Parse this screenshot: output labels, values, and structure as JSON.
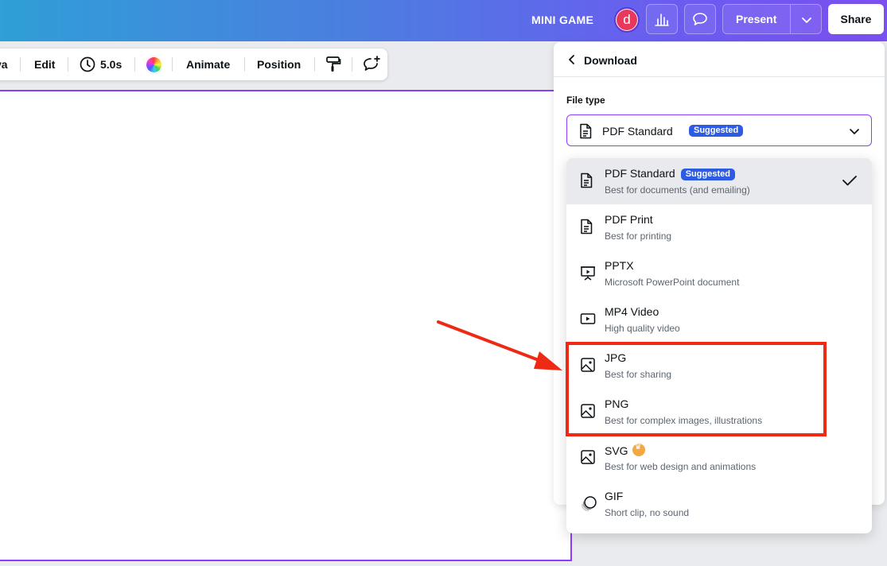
{
  "header": {
    "title": "MINI GAME",
    "avatar_letter": "d",
    "present_label": "Present",
    "share_label": "Share"
  },
  "toolbar": {
    "truncated_label": "va",
    "edit_label": "Edit",
    "duration_label": "5.0s",
    "animate_label": "Animate",
    "position_label": "Position"
  },
  "download_panel": {
    "title": "Download",
    "file_type_label": "File type",
    "selected_value": "PDF Standard",
    "selected_badge": "Suggested",
    "options": [
      {
        "name": "PDF Standard",
        "badge": "Suggested",
        "desc": "Best for documents (and emailing)",
        "icon": "document-icon",
        "selected": true
      },
      {
        "name": "PDF Print",
        "desc": "Best for printing",
        "icon": "document-icon"
      },
      {
        "name": "PPTX",
        "desc": "Microsoft PowerPoint document",
        "icon": "presentation-icon"
      },
      {
        "name": "MP4 Video",
        "desc": "High quality video",
        "icon": "video-icon"
      },
      {
        "name": "JPG",
        "desc": "Best for sharing",
        "icon": "image-icon"
      },
      {
        "name": "PNG",
        "desc": "Best for complex images, illustrations",
        "icon": "image-icon"
      },
      {
        "name": "SVG",
        "desc": "Best for web design and animations",
        "icon": "image-icon",
        "premium": true
      },
      {
        "name": "GIF",
        "desc": "Short clip, no sound",
        "icon": "gif-icon"
      }
    ]
  },
  "colors": {
    "accent": "#8b3dff",
    "badge": "#2d5be3",
    "annotation": "#ee2a14"
  }
}
